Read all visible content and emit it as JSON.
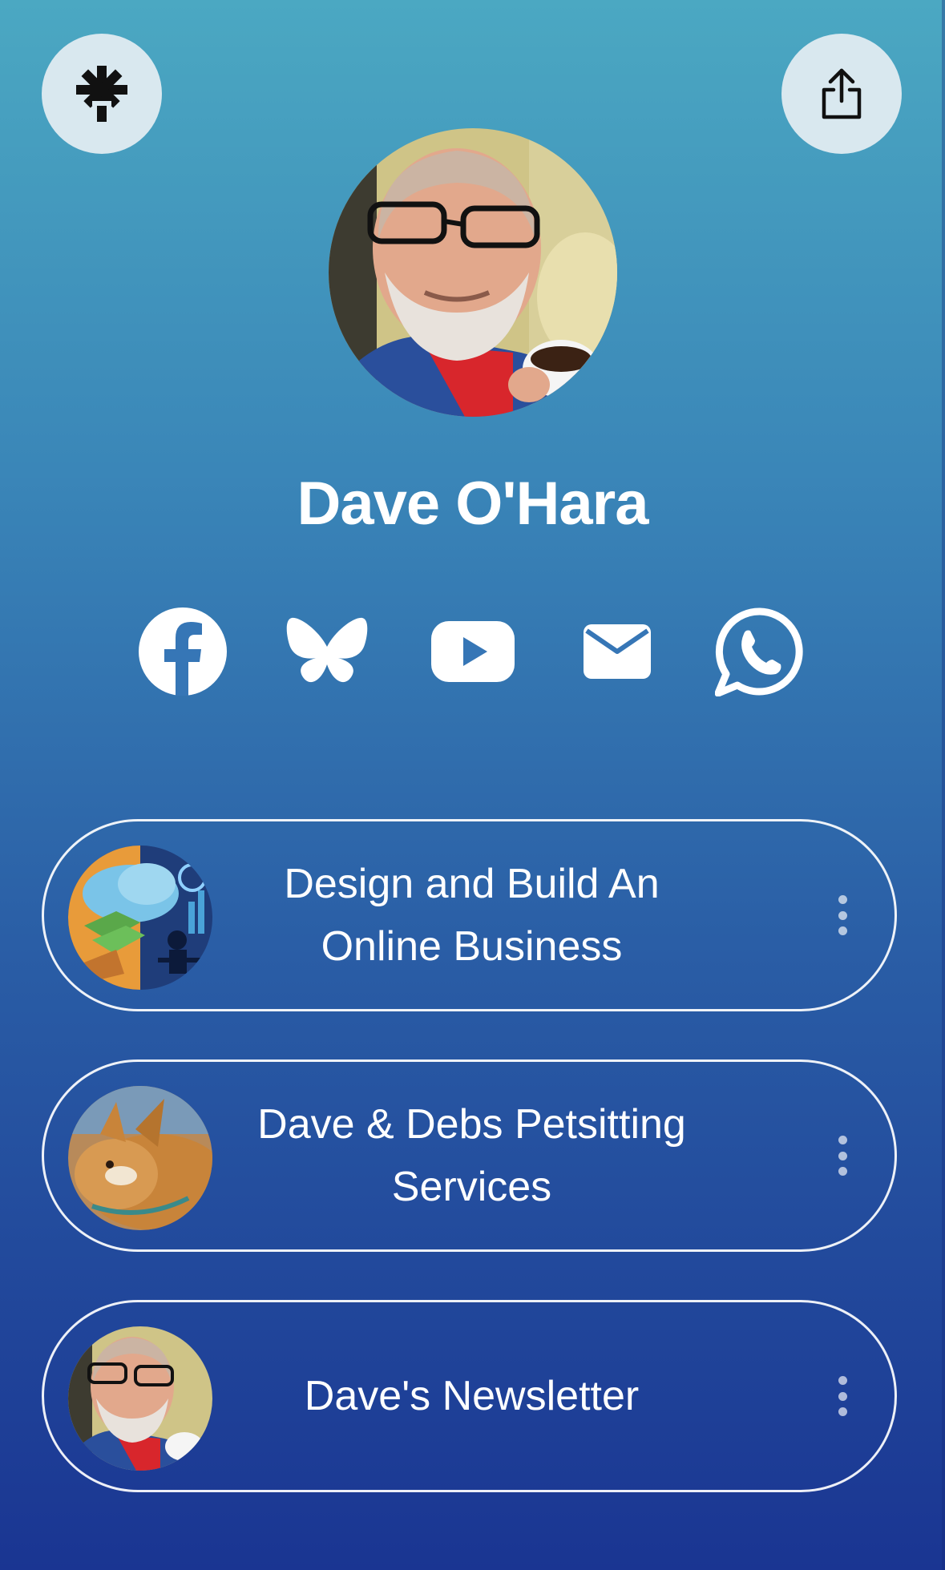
{
  "profile": {
    "name": "Dave O'Hara"
  },
  "header": {
    "logo_icon": "linktree-asterisk-icon",
    "share_icon": "share-icon"
  },
  "socials": [
    {
      "name": "facebook",
      "icon": "facebook-icon"
    },
    {
      "name": "bluesky",
      "icon": "bluesky-icon"
    },
    {
      "name": "youtube",
      "icon": "youtube-icon"
    },
    {
      "name": "email",
      "icon": "mail-icon"
    },
    {
      "name": "whatsapp",
      "icon": "whatsapp-icon"
    }
  ],
  "links": [
    {
      "label_line1": "Design and Build An",
      "label_line2": "Online Business"
    },
    {
      "label_line1": "Dave & Debs Petsitting",
      "label_line2": "Services"
    },
    {
      "label_line1": "Dave's Newsletter",
      "label_line2": ""
    }
  ],
  "colors": {
    "gradient_top": "#4ba8c2",
    "gradient_bottom": "#1a3592",
    "button_bg": "#d9e8ef",
    "text": "#ffffff"
  }
}
